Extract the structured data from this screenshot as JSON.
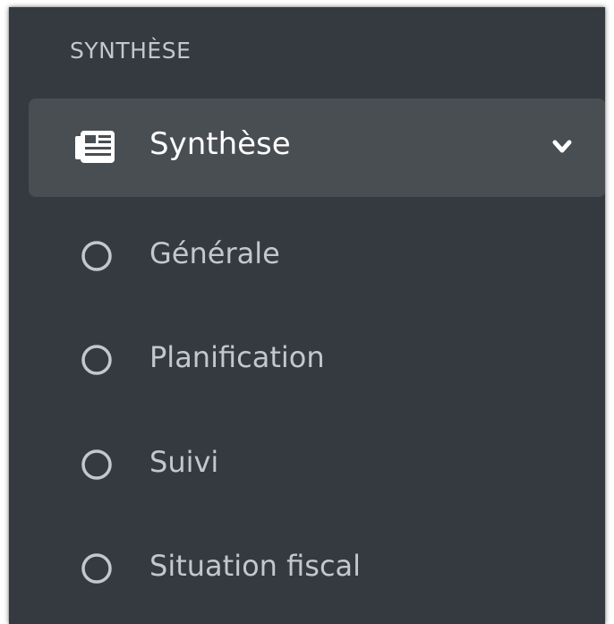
{
  "colors": {
    "sidebar_bg": "#343a40",
    "active_bg": "#494e53",
    "text_muted": "#c2c7d0",
    "text_active": "#ffffff"
  },
  "sidebar": {
    "section_header": "SYNTHÈSE",
    "parent": {
      "label": "Synthèse",
      "icon": "newspaper-icon",
      "expanded": true,
      "toggle_icon": "chevron-down-icon"
    },
    "items": [
      {
        "label": "Générale",
        "icon": "circle-outline-icon"
      },
      {
        "label": "Planification",
        "icon": "circle-outline-icon"
      },
      {
        "label": "Suivi",
        "icon": "circle-outline-icon"
      },
      {
        "label": "Situation fiscal",
        "icon": "circle-outline-icon"
      }
    ]
  }
}
